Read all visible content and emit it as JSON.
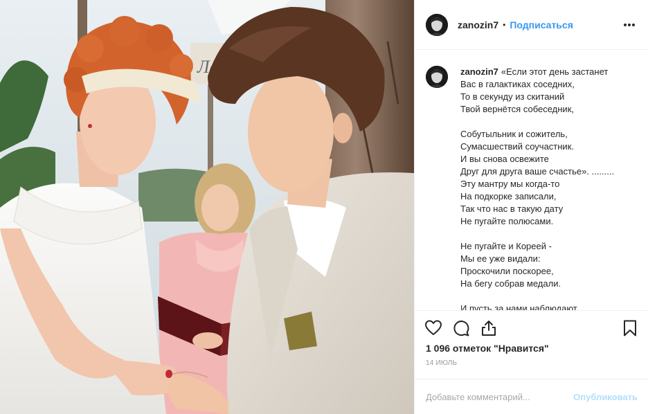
{
  "post_image": {
    "alt": "",
    "sign_fragment": "Ла"
  },
  "header": {
    "username": "zanozin7",
    "separator": "•",
    "follow_label": "Подписаться",
    "more_icon": "more-horizontal-icon"
  },
  "caption": {
    "username": "zanozin7",
    "lines": [
      "«Если этот день застанет",
      "Вас в галактиках соседних,",
      "То в секунду из скитаний",
      "Твой вернётся собеседник,",
      "",
      "Собутыльник и сожитель,",
      "Сумасшествий соучастник.",
      "И вы снова освежите",
      "Друг для друга ваше счастье». .........",
      "Эту мантру мы когда-то",
      "На подкорке записали,",
      "Так что нас в такую дату",
      "Не пугайте полюсами.",
      "",
      "Не пугайте и Кореей -",
      "Мы ее уже видали:",
      "Проскочили поскорее,",
      "На бегу собрав медали.",
      "",
      "И пусть за нами наблюдают"
    ]
  },
  "actions": {
    "like_icon": "heart-icon",
    "comment_icon": "comment-icon",
    "share_icon": "share-icon",
    "save_icon": "bookmark-icon"
  },
  "likes_text": "1 096 отметок \"Нравится\"",
  "date_text": "14 июль",
  "comment_box": {
    "placeholder": "Добавьте комментарий...",
    "publish_label": "Опубликовать"
  },
  "colors": {
    "accent": "#3897f0",
    "publish_disabled": "#b2dffc",
    "text": "#262626",
    "muted": "#999999",
    "border": "#efefef"
  }
}
